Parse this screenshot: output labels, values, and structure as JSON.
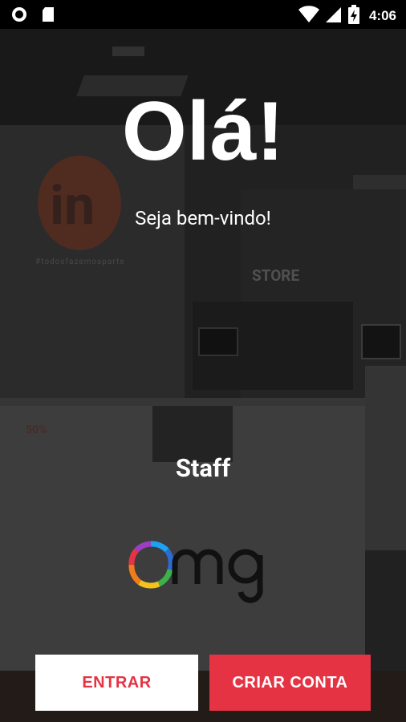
{
  "status_bar": {
    "time": "4:06",
    "icons": [
      "circle-record-icon",
      "sd-card-icon",
      "wifi-icon",
      "signal-icon",
      "battery-charging-icon"
    ]
  },
  "background": {
    "tagline": "#todosfazemosparte",
    "store_sign": "STORE",
    "sale": "50%"
  },
  "welcome": {
    "title": "Olá!",
    "subtitle": "Seja bem-vindo!"
  },
  "role": {
    "label": "Staff"
  },
  "actions": {
    "login_label": "ENTRAR",
    "signup_label": "CRIAR CONTA"
  },
  "colors": {
    "accent": "#e63343",
    "text": "#ffffff"
  }
}
